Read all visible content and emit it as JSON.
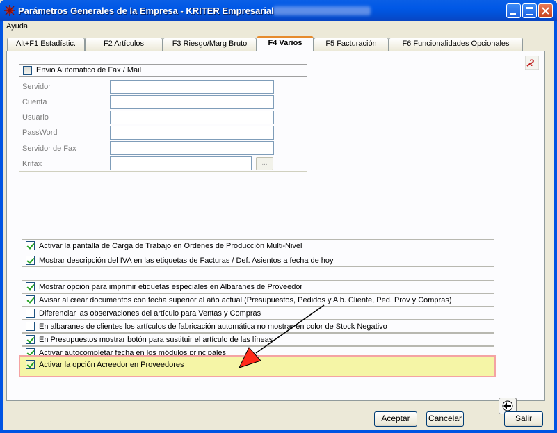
{
  "window": {
    "title": "Parámetros Generales de la Empresa - KRITER Empresarial",
    "colors": {
      "titlebar": "#0054e3",
      "face": "#ece9d8",
      "panel": "#fcfcfe",
      "highlight": "#f5f5a6",
      "highlight_border": "#f4a3a3",
      "arrow": "#ff2a1a",
      "active_tab_top": "#e68b2c"
    }
  },
  "menu": {
    "help": "Ayuda"
  },
  "tabs": [
    {
      "label": "Alt+F1 Estadístic."
    },
    {
      "label": "F2 Artículos"
    },
    {
      "label": "F3 Riesgo/Marg Bruto"
    },
    {
      "label": "F4 Varios",
      "active": true
    },
    {
      "label": "F5 Facturación"
    },
    {
      "label": "F6 Funcionalidades Opcionales"
    }
  ],
  "fax_group": {
    "checkbox_label": "Envio Automatico de Fax / Mail",
    "checked": false,
    "fields": [
      {
        "label": "Servidor",
        "value": ""
      },
      {
        "label": "Cuenta",
        "value": ""
      },
      {
        "label": "Usuario",
        "value": ""
      },
      {
        "label": "PassWord",
        "value": ""
      },
      {
        "label": "Servidor de Fax",
        "value": ""
      },
      {
        "label": "Krifax",
        "value": ""
      }
    ],
    "browse_button": "..."
  },
  "options_a": [
    {
      "label": "Activar la pantalla de Carga de Trabajo en Ordenes de Producción Multi-Nivel",
      "checked": true
    },
    {
      "label": "Mostrar descripción del IVA en las etiquetas de Facturas / Def. Asientos a fecha de hoy",
      "checked": true
    }
  ],
  "options_b": [
    {
      "label": "Mostrar opción para imprimir etiquetas especiales en Albaranes de Proveedor",
      "checked": true
    },
    {
      "label": "Avisar al crear documentos con fecha superior al año actual (Presupuestos, Pedidos y  Alb. Cliente, Ped. Prov y Compras)",
      "checked": true
    },
    {
      "label": "Diferenciar las observaciones del artículo para Ventas y Compras",
      "checked": false
    },
    {
      "label": "En albaranes de clientes los artículos de fabricación automática no mostrar en color de Stock Negativo",
      "checked": false
    },
    {
      "label": "En Presupuestos mostrar botón para sustituir el artículo de las líneas",
      "checked": true
    },
    {
      "label": "Activar autocompletar fecha en los módulos principales",
      "checked": true
    }
  ],
  "highlighted_option": {
    "label": "Activar la opción Acreedor en Proveedores",
    "checked": true
  },
  "buttons": {
    "accept": "Aceptar",
    "cancel": "Cancelar",
    "exit": "Salir"
  },
  "icons": {
    "app": "kriter-app-icon",
    "help": "question-help-icon",
    "back": "back-arrow-icon",
    "annotation": "red-arrow-annotation"
  }
}
